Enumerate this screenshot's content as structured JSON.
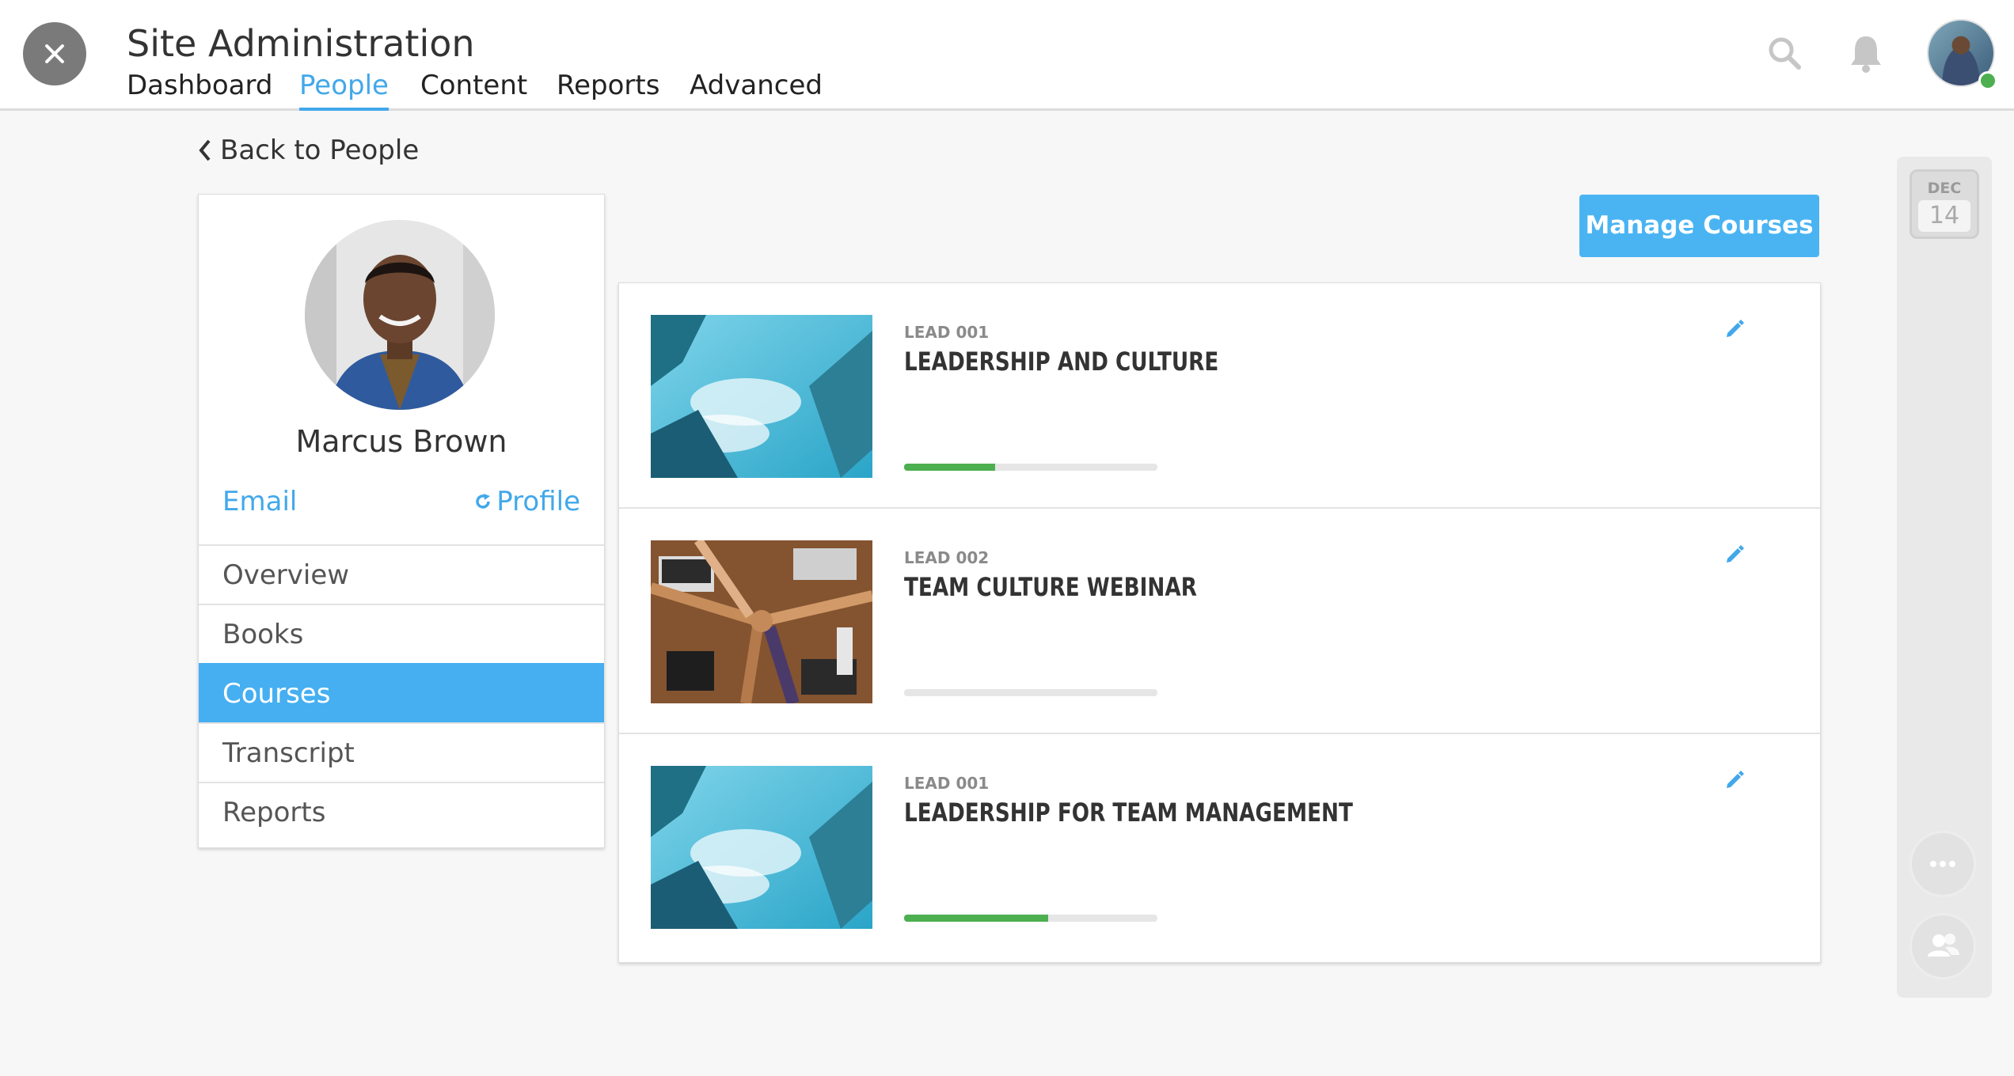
{
  "header": {
    "title": "Site Administration",
    "nav": [
      "Dashboard",
      "People",
      "Content",
      "Reports",
      "Advanced"
    ],
    "active_nav": "People"
  },
  "back_link": "Back to People",
  "profile": {
    "name": "Marcus Brown",
    "email_label": "Email",
    "profile_label": "Profile",
    "menu": [
      "Overview",
      "Books",
      "Courses",
      "Transcript",
      "Reports"
    ],
    "active_menu": "Courses"
  },
  "manage_courses_label": "Manage Courses",
  "courses": [
    {
      "code": "LEAD 001",
      "title": "LEADERSHIP AND CULTURE",
      "progress": 0.36,
      "thumb": "city-sky"
    },
    {
      "code": "LEAD 002",
      "title": "TEAM CULTURE WEBINAR",
      "progress": 0,
      "thumb": "team-fist-bump"
    },
    {
      "code": "LEAD 001",
      "title": "LEADERSHIP FOR TEAM MANAGEMENT",
      "progress": 0.57,
      "thumb": "city-sky"
    }
  ],
  "calendar": {
    "month": "DEC",
    "day": "14"
  },
  "colors": {
    "accent": "#42a8ea",
    "progress": "#4caf50",
    "active_bg": "#45aff1"
  },
  "icons": [
    "close-icon",
    "search-icon",
    "bell-icon",
    "chevron-left-icon",
    "refresh-icon",
    "pencil-icon",
    "more-icon",
    "users-icon"
  ]
}
